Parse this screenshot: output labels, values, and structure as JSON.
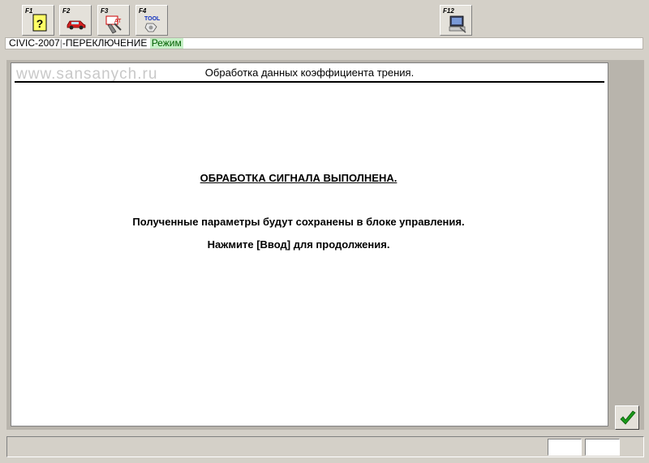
{
  "toolbar": {
    "keys": [
      {
        "label": "F1",
        "icon": "help-icon"
      },
      {
        "label": "F2",
        "icon": "car-icon"
      },
      {
        "label": "F3",
        "icon": "diagnostics-icon"
      },
      {
        "label": "F4",
        "icon": "tool-icon"
      },
      {
        "label": "F12",
        "icon": "computer-icon"
      }
    ],
    "f3_icon_text": "AT",
    "f4_icon_text": "TOOL"
  },
  "statusline": {
    "model": "CIVIC-2007",
    "separator": "|",
    "mode": "-ПЕРЕКЛЮЧЕНИЕ",
    "state": "Режим"
  },
  "watermark": "www.sansanych.ru",
  "panel": {
    "title": "Обработка данных коэффициента трения.",
    "heading": "ОБРАБОТКА СИГНАЛА ВЫПОЛНЕНА.",
    "line1": "Полученные параметры будут сохранены в блоке управления.",
    "line2": "Нажмите [Ввод] для продолжения."
  },
  "colors": {
    "background": "#d4d0c8",
    "panel": "#ffffff",
    "ok_check": "#1a9a1a",
    "state_bg": "#c8f0c8"
  }
}
